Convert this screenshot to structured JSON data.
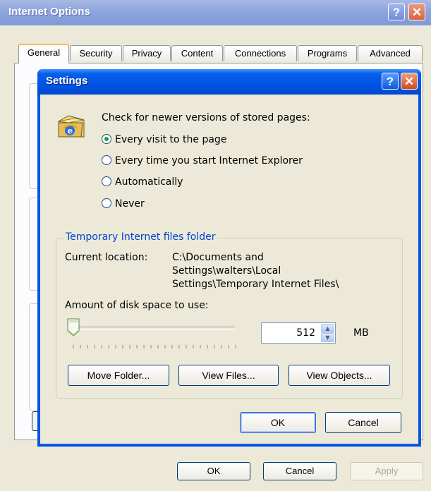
{
  "outer_window": {
    "title": "Internet Options",
    "help_glyph": "?",
    "close_glyph": "✕",
    "tabs": [
      "General",
      "Security",
      "Privacy",
      "Content",
      "Connections",
      "Programs",
      "Advanced"
    ],
    "active_tab": "General",
    "buttons": {
      "ok": "OK",
      "cancel": "Cancel",
      "apply": "Apply"
    }
  },
  "settings_dialog": {
    "title": "Settings",
    "help_glyph": "?",
    "close_glyph": "✕",
    "check_label": "Check for newer versions of stored pages:",
    "radio_options": [
      {
        "label": "Every visit to the page",
        "checked": true
      },
      {
        "label": "Every time you start Internet Explorer",
        "checked": false
      },
      {
        "label": "Automatically",
        "checked": false
      },
      {
        "label": "Never",
        "checked": false
      }
    ],
    "temp_folder": {
      "legend": "Temporary Internet files folder",
      "current_location_label": "Current location:",
      "current_location_lines": [
        "C:\\Documents and",
        "Settings\\walters\\Local",
        "Settings\\Temporary Internet Files\\"
      ],
      "disk_space_label": "Amount of disk space to use:",
      "disk_space_value": "512",
      "disk_space_unit": "MB",
      "slider_fraction": 0.0,
      "buttons": {
        "move_folder": "Move Folder...",
        "view_files": "View Files...",
        "view_objects": "View Objects..."
      }
    },
    "buttons": {
      "ok": "OK",
      "cancel": "Cancel"
    },
    "icons": {
      "folder": "ie-folder-icon",
      "spinner_up": "spin-up-icon",
      "spinner_down": "spin-down-icon"
    },
    "colors": {
      "titlebar": "#0055e5",
      "legend_text": "#0046d5",
      "radio_dot": "#21a121"
    }
  }
}
